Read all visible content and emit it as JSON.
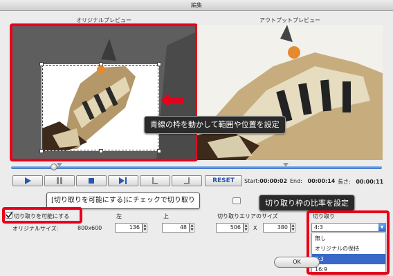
{
  "window": {
    "title": "編集"
  },
  "preview": {
    "original_label": "オリジナルプレビュー",
    "output_label": "アウトプットプレビュー"
  },
  "annotations": {
    "move_crop": "青線の枠を動かして範囲や位置を設定",
    "enable_crop": "[切り取りを可能にする]にチェックで切り取り",
    "ratio": "切り取り枠の比率を設定"
  },
  "timeline": {
    "position_fraction": 0.115
  },
  "controls": {
    "reset_label": "RESET",
    "start_label": "Start:",
    "start_value": "00:00:02",
    "end_label": "End:",
    "end_value": "00:00:14",
    "length_label": "長さ:",
    "length_value": "00:00:11"
  },
  "crop": {
    "enable_label": "切り取りを可能にする",
    "enabled": true,
    "original_size_label": "オリジナルサイズ:",
    "original_size_value": "800x600",
    "left_label": "左",
    "left_value": "136",
    "top_label": "上",
    "top_value": "48",
    "area_size_label": "切り取りエリアのサイズ",
    "width_value": "506",
    "times": "X",
    "height_value": "380",
    "ratio_label": "切り取り",
    "ratio_selected": "4:3",
    "ratio_options": [
      "無し",
      "オリジナルの保持",
      "4:3",
      "16:9"
    ]
  },
  "footer": {
    "ok_label": "OK"
  },
  "colors": {
    "highlight": "#e8001a",
    "selection": "#3a68c8"
  }
}
